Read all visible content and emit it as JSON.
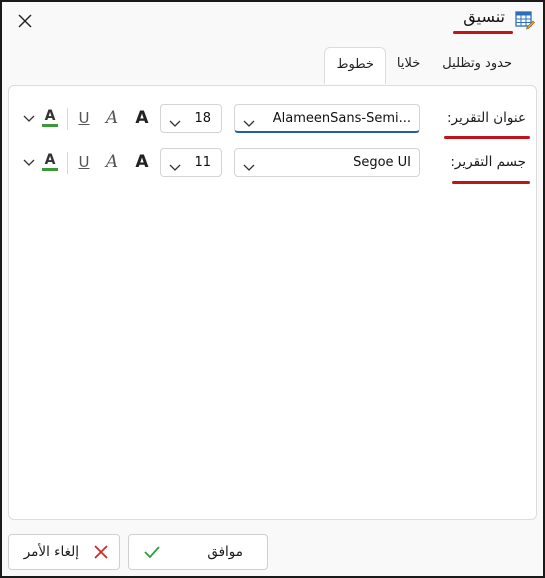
{
  "window": {
    "title": "تنسيق",
    "close_icon": "close-icon",
    "app_icon": "table-edit-icon"
  },
  "tabs": [
    {
      "label": "خطوط",
      "active": true
    },
    {
      "label": "خلايا",
      "active": false
    },
    {
      "label": "حدود وتظليل",
      "active": false
    }
  ],
  "rows": [
    {
      "label": "عنوان التقرير:",
      "font": "AlameenSans-Semi...",
      "size": "18"
    },
    {
      "label": "جسم التقرير:",
      "font": "Segoe UI",
      "size": "11"
    }
  ],
  "format_icons": {
    "bold": "A",
    "italic": "A",
    "underline": "U",
    "color": "A"
  },
  "footer": {
    "ok_label": "موافق",
    "cancel_label": "إلغاء الأمر"
  },
  "colors": {
    "accent_underline": "#c0141b",
    "focus_border": "#1f5fa8",
    "ok_check": "#2e9e3e",
    "cancel_x": "#d02a2a",
    "font_color_bar": "#3a9a3a"
  }
}
